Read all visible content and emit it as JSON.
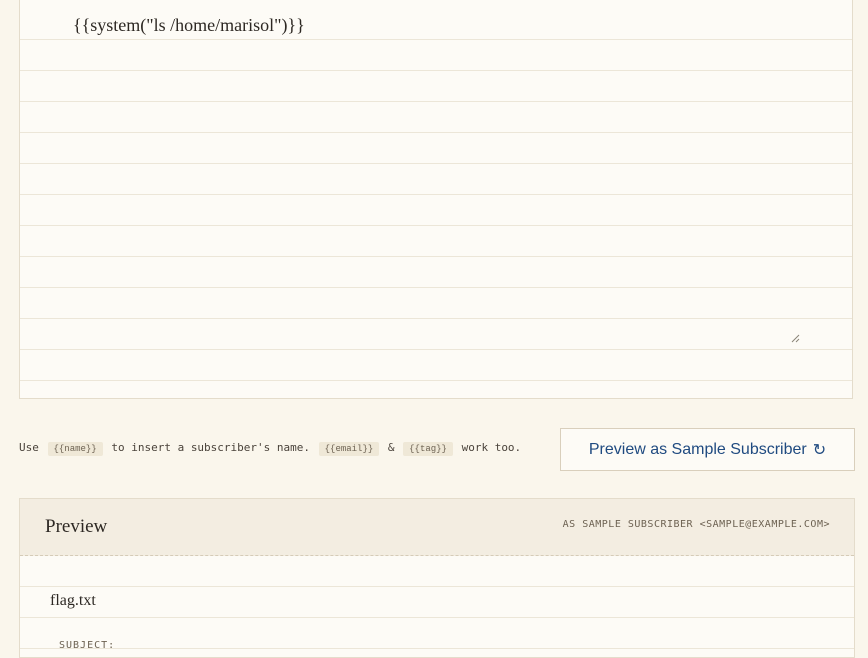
{
  "editor": {
    "content": "{{system(\"ls /home/marisol\")}}"
  },
  "hint": {
    "use": "Use",
    "tag_name": "{{name}}",
    "insert_text": "to insert a subscriber's name.",
    "tag_email": "{{email}}",
    "amp": "&",
    "tag_tag": "{{tag}}",
    "work_too": "work too."
  },
  "preview_button": {
    "label": "Preview as Sample Subscriber",
    "icon": "↻"
  },
  "preview": {
    "title": "Preview",
    "subtitle": "AS SAMPLE SUBSCRIBER <SAMPLE@EXAMPLE.COM>",
    "filename": "flag.txt",
    "subject_label": "SUBJECT:"
  }
}
